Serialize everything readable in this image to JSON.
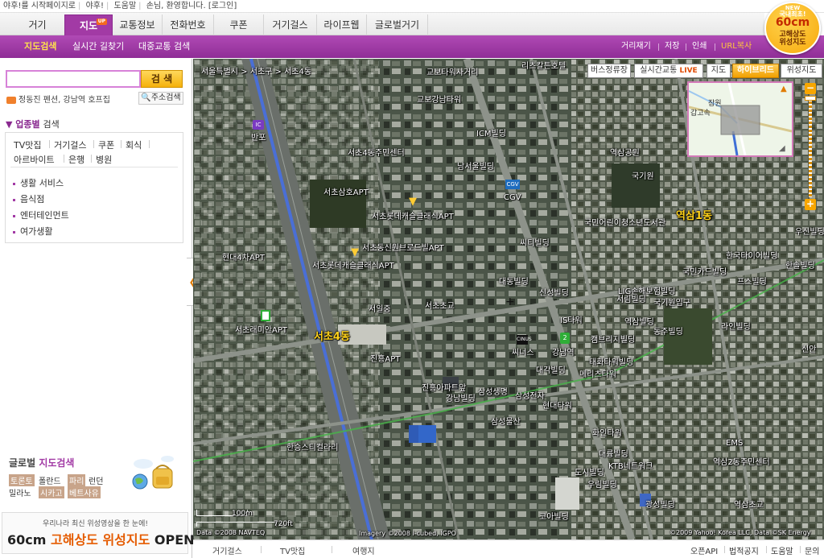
{
  "topbar": {
    "items": [
      "야후!를 시작페이지로",
      "야후!",
      "도움말",
      "손님, 환영합니다. [로그인]"
    ]
  },
  "nav": {
    "tabs": [
      "거기",
      "지도",
      "교통정보",
      "전화번호",
      "쿠폰",
      "거기걸스",
      "라이프웹",
      "글로벌거기"
    ],
    "active": "지도",
    "badge": "UP"
  },
  "subnav": {
    "left": [
      "지도검색",
      "실시간 길찾기",
      "대중교통 검색"
    ],
    "right": [
      "거리재기",
      "저장",
      "인쇄",
      "URL복사"
    ]
  },
  "promo": {
    "line1": "NEW",
    "line2": "국내최초!",
    "line3": "60cm",
    "line4": "고해상도",
    "line5": "위성지도"
  },
  "sidebar": {
    "search_button": "검 색",
    "hint": "정동진 펜션, 강남역 호프집",
    "address_button": "주소검색",
    "category_title": "업종별",
    "category_title2": "검색",
    "quick_links": [
      "TV맛집",
      "거기걸스",
      "쿠폰",
      "회식",
      "아르바이트",
      "은행",
      "병원"
    ],
    "categories": [
      "생활 서비스",
      "음식점",
      "엔터테인먼트",
      "여가생활"
    ],
    "global_title": "글로벌",
    "global_title2": "지도검색",
    "cities_row1": [
      "토론토",
      "폴란드",
      "파리",
      "런던"
    ],
    "cities_row2": [
      "밀라노",
      "시카고",
      "베트사유"
    ],
    "promo_line1": "우리나라 최신 위성영상을 한 눈에!",
    "promo_line2a": "60cm",
    "promo_line2b": "고해상도 위성지도",
    "promo_line2c": "OPEN !"
  },
  "map": {
    "breadcrumb": [
      "서울특별시",
      "서초구",
      "서초4동"
    ],
    "buttons": [
      "버스정류장",
      "실시간교통",
      "지도",
      "하이브리드",
      "위성지도"
    ],
    "live": "LIVE",
    "active_view": "하이브리드",
    "scale_m": "100m",
    "scale_ft": "720ft",
    "copyright_left": "Data ©2008 NAVTEQ",
    "copyright_mid": "Imagery ©2008 i-cubed, IGPO",
    "copyright_right": "©2009 Yahoo! Korea LLC, Data ©SK Energy",
    "labels": [
      {
        "text": "리츠칼튼호텔",
        "big": false
      },
      {
        "text": "교보타워사거리",
        "big": false
      },
      {
        "text": "교보강남타워",
        "big": false
      },
      {
        "text": "ICM빌딩",
        "big": false
      },
      {
        "text": "서초4동주민센터",
        "big": false
      },
      {
        "text": "남서울빌딩",
        "big": false
      },
      {
        "text": "역삼공원",
        "big": false
      },
      {
        "text": "국기원",
        "big": false
      },
      {
        "text": "서초삼호APT",
        "big": false
      },
      {
        "text": "CGV",
        "big": false
      },
      {
        "text": "서초롯데캐슬클래식APT",
        "big": false
      },
      {
        "text": "국민어린이청소년도서관",
        "big": false
      },
      {
        "text": "역삼1동",
        "big": true
      },
      {
        "text": "우신빌딩",
        "big": false
      },
      {
        "text": "서초동신원브로드빌APT",
        "big": false
      },
      {
        "text": "씨티빌딩",
        "big": false
      },
      {
        "text": "현대4차APT",
        "big": false
      },
      {
        "text": "서초롯데캐슬클래식APT",
        "big": false
      },
      {
        "text": "한국타이어빌딩",
        "big": false
      },
      {
        "text": "한솔빌딩",
        "big": false
      },
      {
        "text": "국민카드빌딩",
        "big": false
      },
      {
        "text": "대동빌딩",
        "big": false
      },
      {
        "text": "신성빌딩",
        "big": false
      },
      {
        "text": "프스빌딩",
        "big": false
      },
      {
        "text": "LIG손해보험빌딩",
        "big": false
      },
      {
        "text": "서림빌딩",
        "big": false
      },
      {
        "text": "국기원입구",
        "big": false
      },
      {
        "text": "서일중",
        "big": false
      },
      {
        "text": "서초초교",
        "big": false
      },
      {
        "text": "IS타워",
        "big": false
      },
      {
        "text": "역삼빌딩",
        "big": false
      },
      {
        "text": "라인빌딩",
        "big": false
      },
      {
        "text": "서초래미안APT",
        "big": false
      },
      {
        "text": "동주빌딩",
        "big": false
      },
      {
        "text": "서초4동",
        "big": true
      },
      {
        "text": "캠브리지빌딩",
        "big": false
      },
      {
        "text": "씨너스",
        "big": false
      },
      {
        "text": "강남역",
        "big": false
      },
      {
        "text": "태화타워빌딩",
        "big": false
      },
      {
        "text": "진흥APT",
        "big": false
      },
      {
        "text": "대각빌딩",
        "big": false
      },
      {
        "text": "메리츠타워",
        "big": false
      },
      {
        "text": "신안",
        "big": false
      },
      {
        "text": "진흥아파트앞",
        "big": false
      },
      {
        "text": "삼성생명",
        "big": false
      },
      {
        "text": "강남빌딩",
        "big": false
      },
      {
        "text": "삼성전자",
        "big": false
      },
      {
        "text": "현대타워",
        "big": false
      },
      {
        "text": "삼성물산",
        "big": false
      },
      {
        "text": "화인타워",
        "big": false
      },
      {
        "text": "한승스티컬라리",
        "big": false
      },
      {
        "text": "대륭빌딩",
        "big": false
      },
      {
        "text": "EMS",
        "big": false
      },
      {
        "text": "KTB네트워크",
        "big": false
      },
      {
        "text": "역삼2동주민센터",
        "big": false
      },
      {
        "text": "도시빌딩",
        "big": false
      },
      {
        "text": "우림빌딩",
        "big": false
      },
      {
        "text": "광성빌딩",
        "big": false
      },
      {
        "text": "코아빌딩",
        "big": false
      },
      {
        "text": "역삼초교",
        "big": false
      },
      {
        "text": "반포",
        "big": false
      }
    ],
    "minimap_labels": [
      "잠원",
      "갑고속"
    ]
  },
  "footer": {
    "tabs": [
      "거기걸스",
      "TV맛집",
      "여행지"
    ],
    "right": [
      "오픈API",
      "법적공지",
      "도움말",
      "문의"
    ]
  },
  "colors": {
    "brand": "#a23aa5",
    "accent": "#f5b10c",
    "active_sub": "#ffe14d"
  }
}
